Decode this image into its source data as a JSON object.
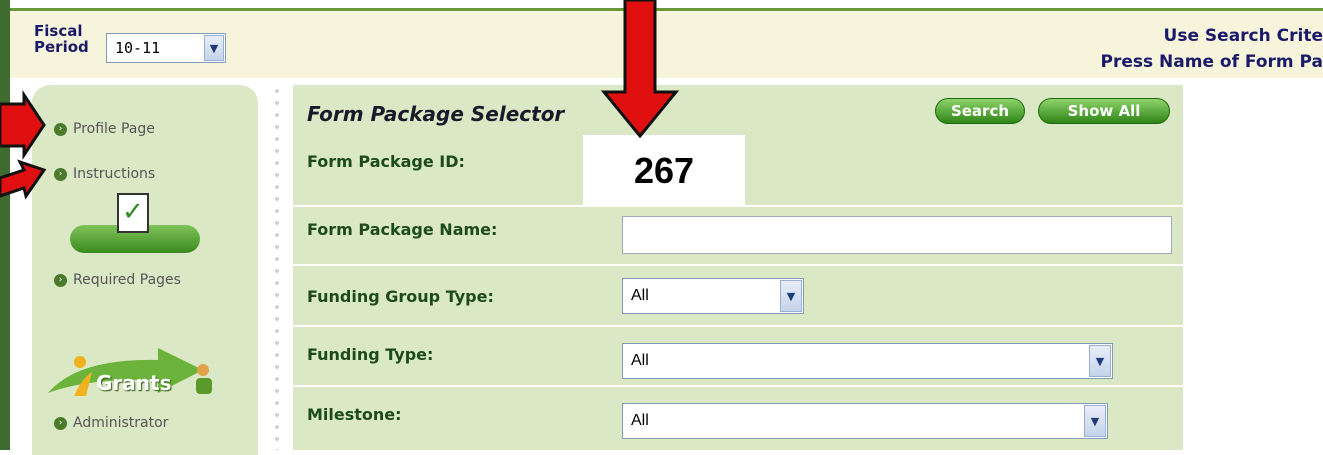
{
  "header": {
    "fiscal_label": "Fiscal Period",
    "fiscal_value": "10-11",
    "right_line1": "Use Search Crite",
    "right_line2": "Press Name of Form Pa"
  },
  "sidebar": {
    "items": [
      {
        "label": "Profile Page"
      },
      {
        "label": "Instructions"
      },
      {
        "label": "Required Pages"
      },
      {
        "label": "Administrator"
      }
    ],
    "logo_text": "Grants"
  },
  "main": {
    "title": "Form Package Selector",
    "search_label": "Search",
    "show_all_label": "Show All",
    "fields": {
      "package_id": {
        "label": "Form Package ID:",
        "value": "267"
      },
      "package_name": {
        "label": "Form Package Name:",
        "value": ""
      },
      "funding_group_type": {
        "label": "Funding Group Type:",
        "value": "All"
      },
      "funding_type": {
        "label": "Funding Type:",
        "value": "All"
      },
      "milestone": {
        "label": "Milestone:",
        "value": "All"
      }
    }
  },
  "colors": {
    "panel_green": "#dbe8c6",
    "arrow_red": "#e11010",
    "header_text": "#1a1a6a"
  },
  "icons": [
    "checklist-icon",
    "dropdown-arrow-icon",
    "bullet-arrow-icon",
    "igrants-logo"
  ]
}
